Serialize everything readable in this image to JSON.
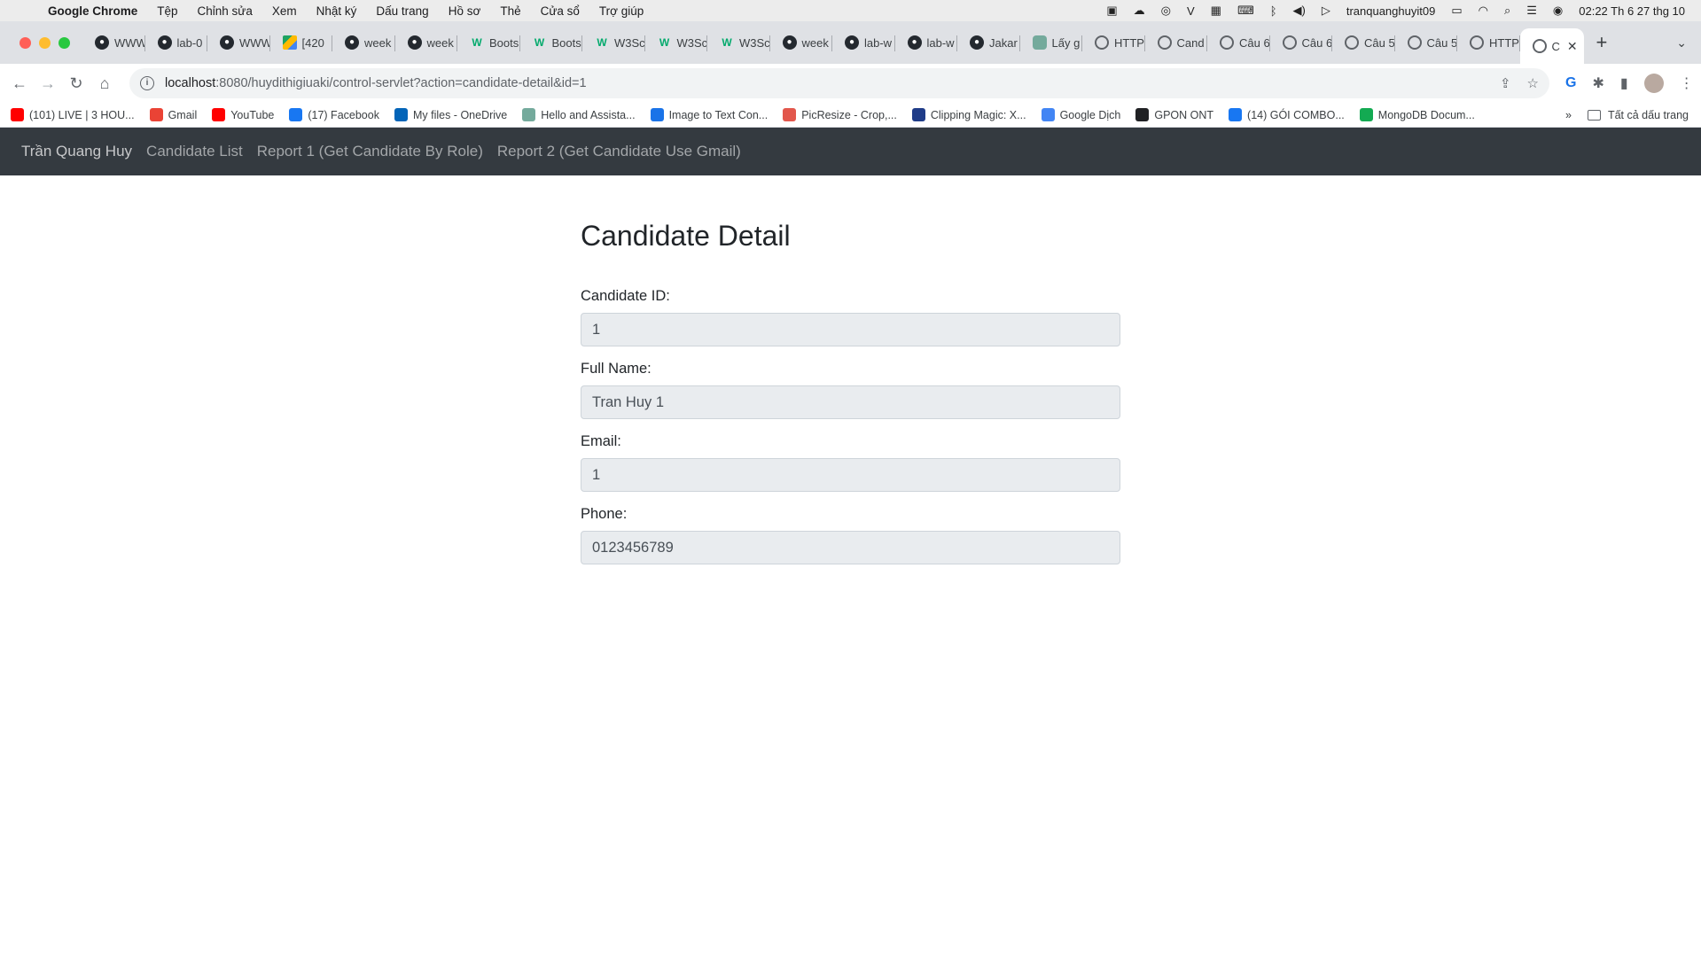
{
  "menubar": {
    "apple_glyph": "",
    "app_name": "Google Chrome",
    "items": [
      "Tệp",
      "Chỉnh sửa",
      "Xem",
      "Nhật ký",
      "Dấu trang",
      "Hồ sơ",
      "Thẻ",
      "Cửa sổ",
      "Trợ giúp"
    ],
    "user": "tranquanghuyit09",
    "clock": "02:22 Th 6 27 thg 10",
    "tray_icons": [
      "w-icon",
      "cloud-icon",
      "creative-cloud-icon",
      "v-icon",
      "grid-icon",
      "keyboard-icon",
      "bluetooth-icon",
      "volume-icon",
      "play-icon",
      "battery-icon",
      "wifi-icon",
      "spotlight-icon",
      "control-center-icon",
      "siri-icon"
    ]
  },
  "tabs": [
    {
      "label": "WWW",
      "icon": "github-icon"
    },
    {
      "label": "lab-0",
      "icon": "github-icon"
    },
    {
      "label": "WWW",
      "icon": "github-icon"
    },
    {
      "label": "[420",
      "icon": "drive-icon"
    },
    {
      "label": "week",
      "icon": "github-icon"
    },
    {
      "label": "week",
      "icon": "github-icon"
    },
    {
      "label": "Boots",
      "icon": "w3schools-icon"
    },
    {
      "label": "Boots",
      "icon": "w3schools-icon"
    },
    {
      "label": "W3Sc",
      "icon": "w3schools-icon"
    },
    {
      "label": "W3Sc",
      "icon": "w3schools-icon"
    },
    {
      "label": "W3Sc",
      "icon": "w3schools-icon"
    },
    {
      "label": "week",
      "icon": "github-icon"
    },
    {
      "label": "lab-w",
      "icon": "github-icon"
    },
    {
      "label": "lab-w",
      "icon": "github-icon"
    },
    {
      "label": "Jakar",
      "icon": "github-icon"
    },
    {
      "label": "Lấy g",
      "icon": "chatgpt-icon"
    },
    {
      "label": "HTTP",
      "icon": "globe-icon"
    },
    {
      "label": "Cand",
      "icon": "globe-icon"
    },
    {
      "label": "Câu 6",
      "icon": "globe-icon"
    },
    {
      "label": "Câu 6",
      "icon": "globe-icon"
    },
    {
      "label": "Câu 5",
      "icon": "globe-icon"
    },
    {
      "label": "Câu 5",
      "icon": "globe-icon"
    },
    {
      "label": "HTTP",
      "icon": "globe-icon"
    }
  ],
  "active_tab": {
    "label": "C",
    "close": "✕"
  },
  "new_tab": "+",
  "tab_menu": "⌄",
  "toolbar": {
    "back": "←",
    "forward": "→",
    "reload": "↻",
    "home": "⌂",
    "url_host": "localhost",
    "url_path": ":8080/huydithigiuaki/control-servlet?action=candidate-detail&id=1",
    "share": "⇪",
    "star": "☆",
    "translate": "G",
    "extensions": "✱",
    "sidepanel": "▮",
    "menu": "⋮"
  },
  "bookmarks": [
    {
      "label": "(101) LIVE | 3 HOU...",
      "color": "#ff0000"
    },
    {
      "label": "Gmail",
      "color": "#ea4335"
    },
    {
      "label": "YouTube",
      "color": "#ff0000"
    },
    {
      "label": "(17) Facebook",
      "color": "#1877f2"
    },
    {
      "label": "My files - OneDrive",
      "color": "#0364b8"
    },
    {
      "label": "Hello and Assista...",
      "color": "#74aa9c"
    },
    {
      "label": "Image to Text Con...",
      "color": "#1a73e8"
    },
    {
      "label": "PicResize - Crop,...",
      "color": "#e2574c"
    },
    {
      "label": "Clipping Magic: X...",
      "color": "#1f3c88"
    },
    {
      "label": "Google Dịch",
      "color": "#4285f4"
    },
    {
      "label": "GPON ONT",
      "color": "#202124"
    },
    {
      "label": "(14) GÓI COMBO...",
      "color": "#1877f2"
    },
    {
      "label": "MongoDB Docum...",
      "color": "#13aa52"
    }
  ],
  "bookmarks_more": "»",
  "bookmarks_all": "Tất cả dấu trang",
  "nav": {
    "brand": "Trần Quang Huy",
    "links": [
      "Candidate List",
      "Report 1 (Get Candidate By Role)",
      "Report 2 (Get Candidate Use Gmail)"
    ]
  },
  "page": {
    "title": "Candidate Detail",
    "fields": [
      {
        "label": "Candidate ID:",
        "value": "1"
      },
      {
        "label": "Full Name:",
        "value": "Tran Huy 1"
      },
      {
        "label": "Email:",
        "value": "1"
      },
      {
        "label": "Phone:",
        "value": "0123456789"
      }
    ]
  },
  "colors": {
    "navbar_bg": "#343a40",
    "input_bg": "#e9ecef",
    "traffic_red": "#ff5f57",
    "traffic_yellow": "#febc2e",
    "traffic_green": "#28c840"
  }
}
